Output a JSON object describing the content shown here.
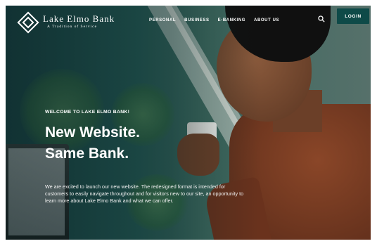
{
  "brand": {
    "name": "Lake Elmo Bank",
    "tagline": "A Tradition of Service"
  },
  "nav": {
    "items": [
      {
        "label": "PERSONAL"
      },
      {
        "label": "BUSINESS"
      },
      {
        "label": "E-BANKING"
      },
      {
        "label": "ABOUT US"
      }
    ],
    "search_icon": "search-icon",
    "login_label": "LOGIN"
  },
  "hero": {
    "eyebrow": "WELCOME TO LAKE ELMO BANK!",
    "headline_line1": "New Website.",
    "headline_line2": "Same Bank.",
    "body": "We are excited to launch our new website.  The redesigned format is intended for customers to easily navigate throughout and for visitors new to our site, an opportunity to learn more about Lake Elmo Bank and what we can offer."
  },
  "colors": {
    "accent": "#0e4a48",
    "text": "#ffffff"
  }
}
